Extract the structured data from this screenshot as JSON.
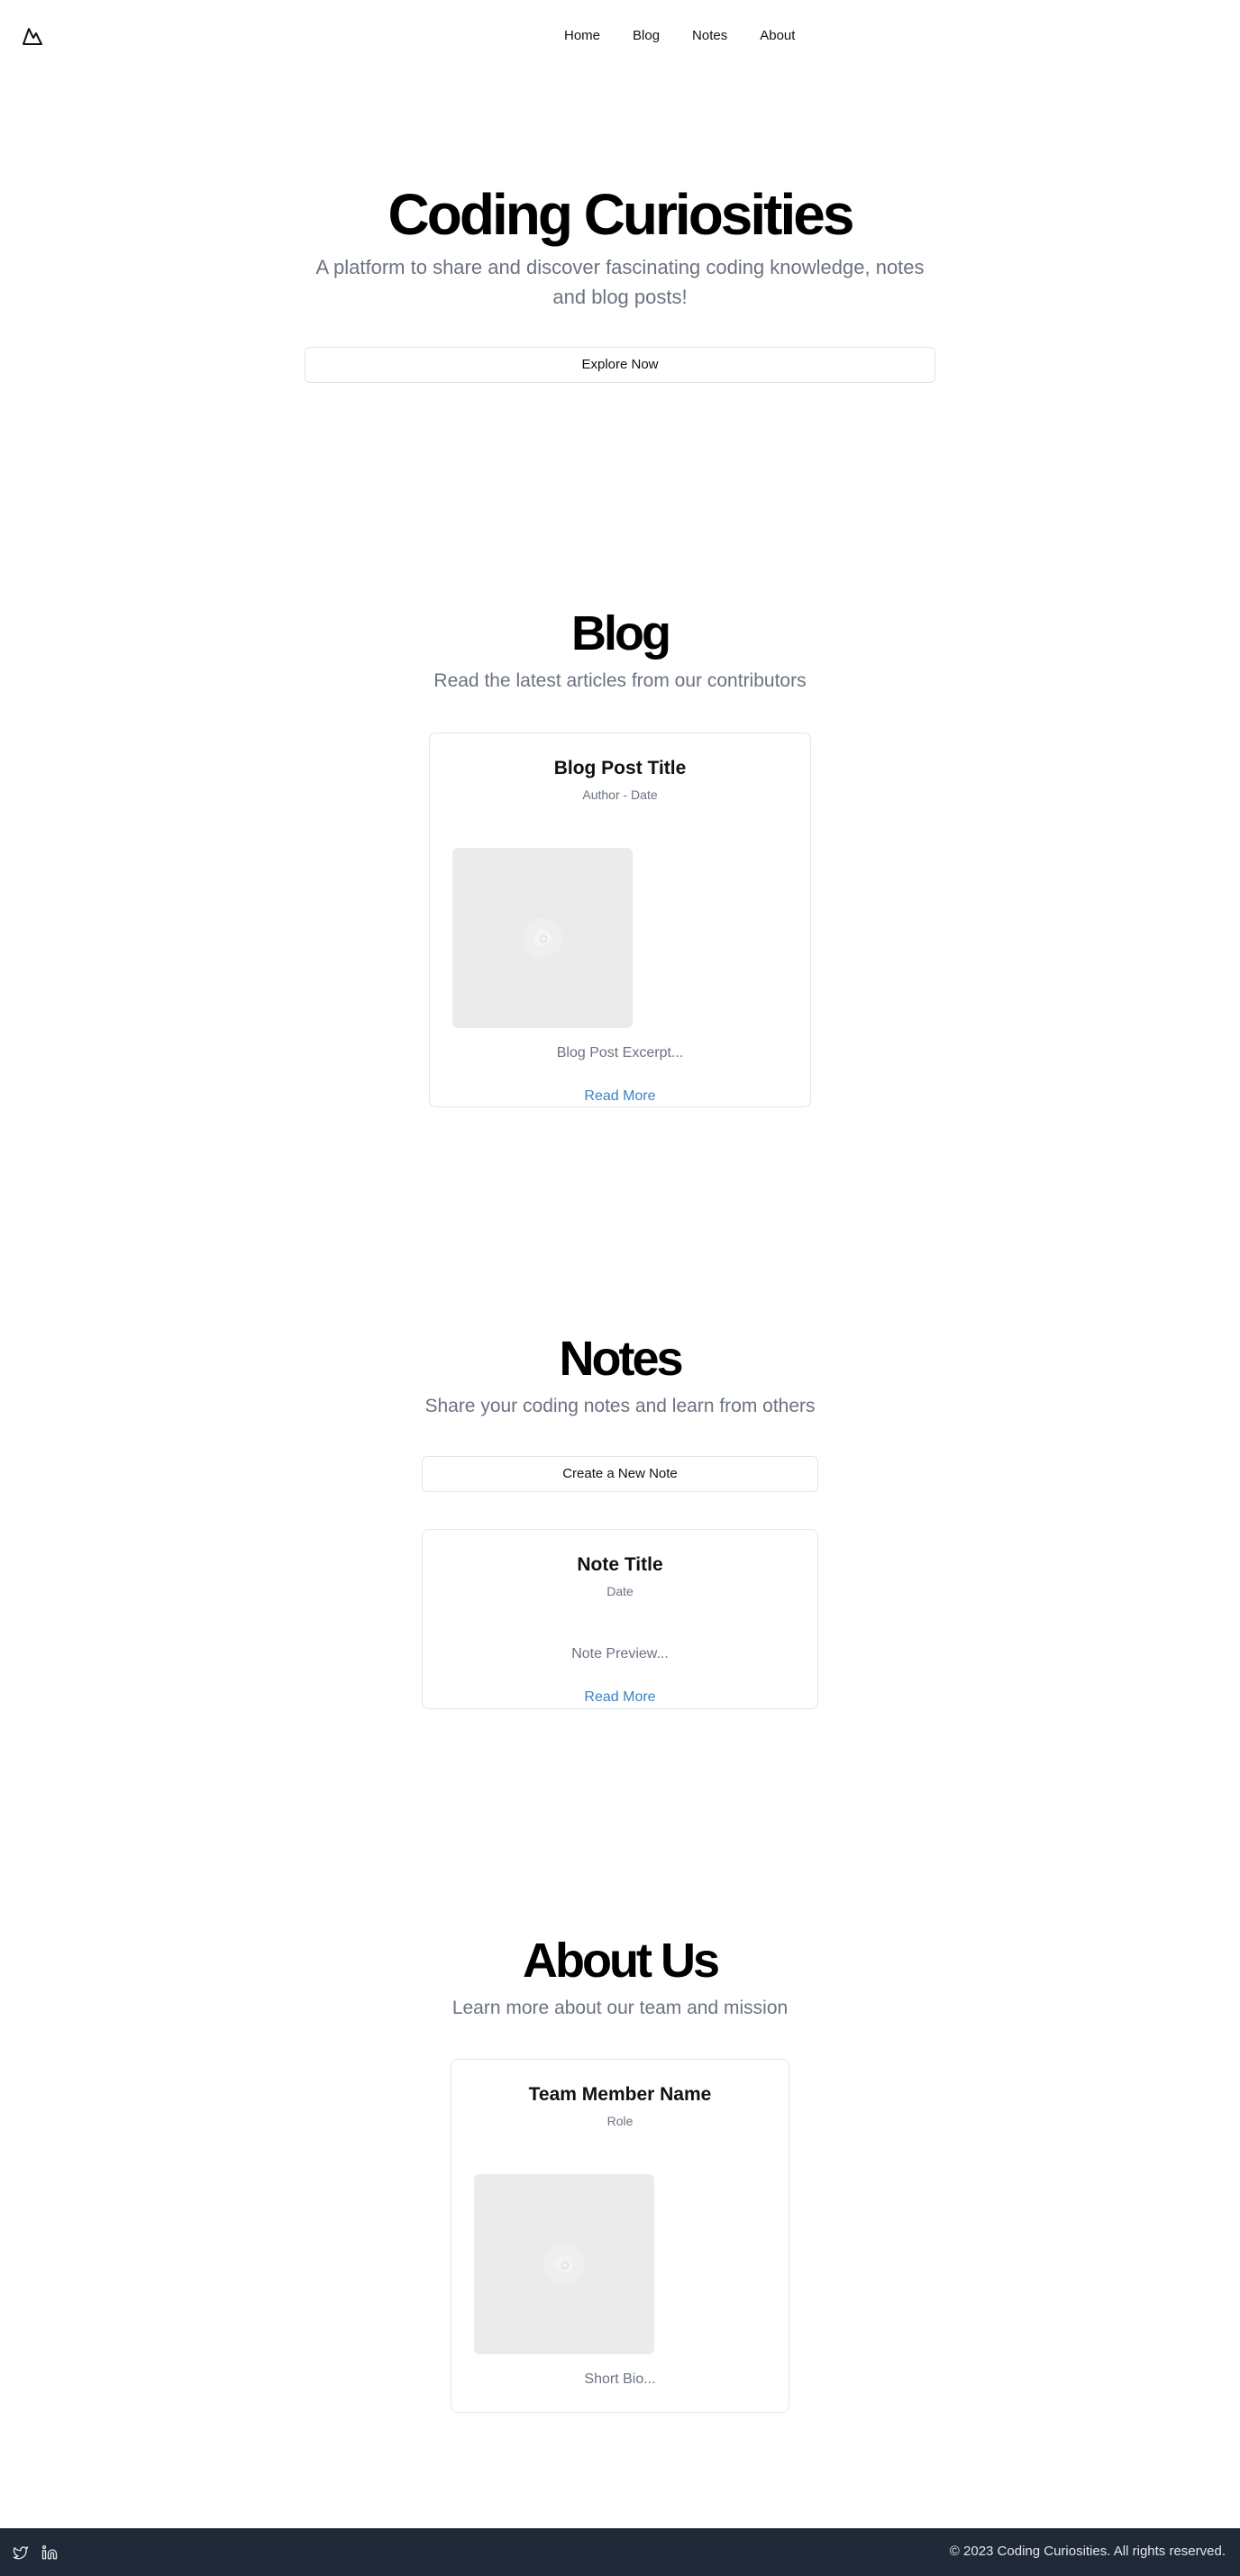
{
  "nav": {
    "logo_icon": "mountain-logo-icon",
    "items": [
      "Home",
      "Blog",
      "Notes",
      "About"
    ]
  },
  "hero": {
    "title": "Coding Curiosities",
    "subtitle_line1": "A platform to share and discover fascinating coding knowledge, notes",
    "subtitle_line2": "and blog posts!",
    "cta": "Explore Now"
  },
  "blog": {
    "title": "Blog",
    "subtitle": "Read the latest articles from our contributors",
    "post": {
      "title": "Blog Post Title",
      "meta": "Author - Date",
      "image_icon": "image-placeholder-icon",
      "excerpt": "Blog Post Excerpt...",
      "link": "Read More"
    }
  },
  "notes": {
    "title": "Notes",
    "subtitle": "Share your coding notes and learn from others",
    "create_button": "Create a New Note",
    "note": {
      "title": "Note Title",
      "meta": "Date",
      "preview": "Note Preview...",
      "link": "Read More"
    }
  },
  "about": {
    "title": "About Us",
    "subtitle": "Learn more about our team and mission",
    "member": {
      "name": "Team Member Name",
      "role": "Role",
      "image_icon": "image-placeholder-icon",
      "bio": "Short Bio..."
    }
  },
  "footer": {
    "social_icons": [
      "twitter-icon",
      "linkedin-icon"
    ],
    "copyright": "© 2023 Coding Curiosities. All rights reserved."
  },
  "colors": {
    "text": "#111111",
    "muted": "#6b7280",
    "link": "#3b82c4",
    "footer_bg": "#1f2937",
    "placeholder_bg": "#ebebeb"
  }
}
